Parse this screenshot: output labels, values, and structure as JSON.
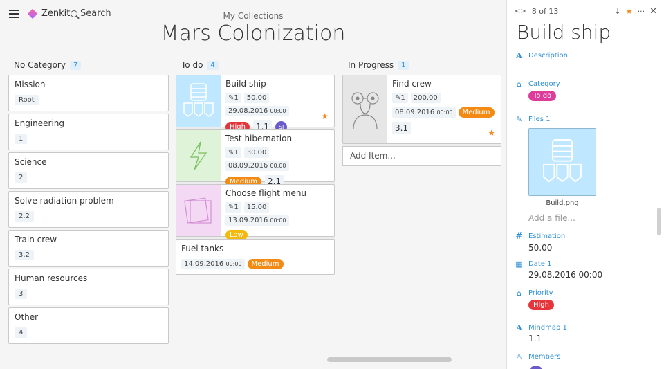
{
  "topbar": {
    "app_name": "Zenkit",
    "search_label": "Search",
    "collections_label": "My Collections",
    "board_title": "Mars Colonization"
  },
  "columns": [
    {
      "title": "No Category",
      "count": "7",
      "cards": [
        {
          "title": "Mission",
          "chip": "Root"
        },
        {
          "title": "Engineering",
          "chip": "1"
        },
        {
          "title": "Science",
          "chip": "2"
        },
        {
          "title": "Solve radiation problem",
          "chip": "2.2"
        },
        {
          "title": "Train crew",
          "chip": "3.2"
        },
        {
          "title": "Human resources",
          "chip": "3"
        },
        {
          "title": "Other",
          "chip": "4"
        }
      ]
    },
    {
      "title": "To do",
      "count": "4",
      "cards": [
        {
          "title": "Build ship",
          "attach": "✎1",
          "estimate": "50.00",
          "date": "29.08.2016",
          "time": "00:00",
          "priority": "High",
          "mindmap": "1.1",
          "member": "SI"
        },
        {
          "title": "Test hibernation",
          "attach": "✎1",
          "estimate": "30.00",
          "date": "08.09.2016",
          "time": "00:00",
          "priority": "Medium",
          "mindmap": "2.1"
        },
        {
          "title": "Choose flight menu",
          "attach": "✎1",
          "estimate": "15.00",
          "date": "13.09.2016",
          "time": "00:00",
          "priority": "Low"
        },
        {
          "title": "Fuel tanks",
          "date": "14.09.2016",
          "time": "00:00",
          "priority": "Medium"
        }
      ]
    },
    {
      "title": "In Progress",
      "count": "1",
      "cards": [
        {
          "title": "Find crew",
          "attach": "✎1",
          "estimate": "200.00",
          "date": "08.09.2016",
          "time": "00:00",
          "priority": "Medium",
          "mindmap": "3.1"
        }
      ],
      "add_item": "Add Item..."
    }
  ],
  "panel": {
    "position": "8 of 13",
    "title": "Build ship",
    "description_label": "Description",
    "category_label": "Category",
    "category_value": "To do",
    "files_label": "Files 1",
    "file_name": "Build.png",
    "add_file_placeholder": "Add a file...",
    "estimation_label": "Estimation",
    "estimation_value": "50.00",
    "date_label": "Date 1",
    "date_value": "29.08.2016 00:00",
    "priority_label": "Priority",
    "priority_value": "High",
    "mindmap_label": "Mindmap 1",
    "mindmap_value": "1.1",
    "members_label": "Members"
  },
  "colors": {
    "accent": "#2d8fd5",
    "high": "#e5353a",
    "medium": "#f28a13",
    "low": "#f5b80c",
    "category": "#dd3c9a",
    "star": "#f08a1c"
  },
  "icons": [
    "menu-icon",
    "zenkit-logo-icon",
    "search-icon",
    "star-icon",
    "text-icon",
    "tag-icon",
    "paperclip-icon",
    "hash-icon",
    "calendar-icon",
    "user-icon",
    "close-icon",
    "more-icon",
    "arrow-down-icon",
    "code-nav-icon"
  ]
}
